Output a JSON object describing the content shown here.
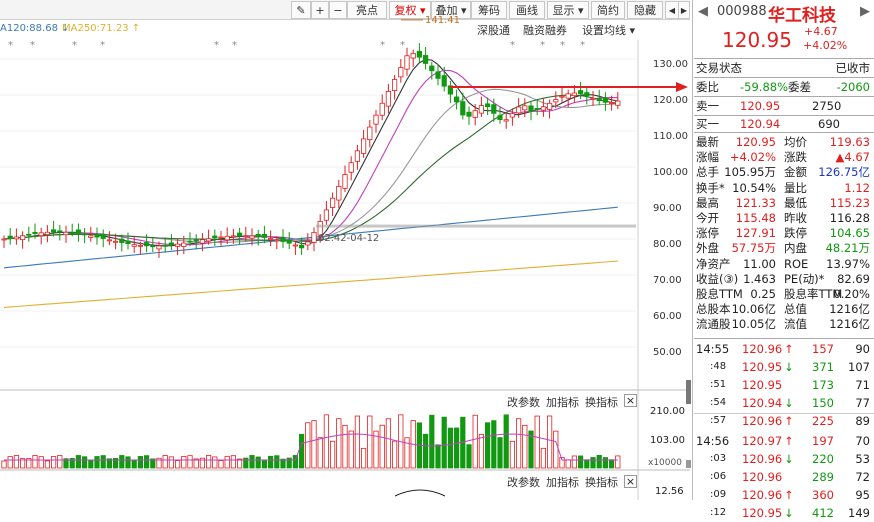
{
  "toolbar": {
    "items": [
      {
        "label": "✎",
        "name": "draw-icon"
      },
      {
        "label": "+",
        "name": "zoom-in-icon"
      },
      {
        "label": "−",
        "name": "zoom-out-icon"
      },
      {
        "label": "亮点"
      },
      {
        "label": "复权 ▾"
      },
      {
        "label": "叠加 ▾"
      },
      {
        "label": "筹码"
      },
      {
        "label": "画线"
      },
      {
        "label": "显示 ▾"
      },
      {
        "label": "简约"
      },
      {
        "label": "隐藏"
      }
    ]
  },
  "subtoolbar": {
    "shenzhen_link": "深股通",
    "margin": "融资融券",
    "ma_setting": "设置均线 ▾",
    "ma120": "A120:88.68 ↓",
    "ma250": "MA250:71.23 ↑"
  },
  "main_chart": {
    "y_ticks": [
      "130.00",
      "120.00",
      "110.00",
      "100.00",
      "90.00",
      "80.00",
      "70.00",
      "60.00",
      "50.00"
    ],
    "high_annotation": "141.41",
    "low_annotation": "62.42-04-12"
  },
  "volume_panel": {
    "buttons": [
      "改参数",
      "加指标",
      "换指标"
    ],
    "close_label": "×",
    "y_ticks": [
      "210.00",
      "103.00",
      "x10000"
    ]
  },
  "macd_panel": {
    "buttons": [
      "改参数",
      "加指标",
      "换指标"
    ],
    "close_label": "×",
    "y_ticks": [
      "12.56"
    ]
  },
  "quote": {
    "code": "000988",
    "name": "华工科技",
    "price": "120.95",
    "change": "+4.67",
    "change_pct": "+4.02%",
    "status_label": "交易状态",
    "status_value": "已收市",
    "weibi_label": "委比",
    "weibi_value": "-59.88%",
    "weicha_label": "委差",
    "weicha_value": "-2060",
    "sell1_label": "卖一",
    "sell1_price": "120.95",
    "sell1_vol": "2750",
    "buy1_label": "买一",
    "buy1_price": "120.94",
    "buy1_vol": "690",
    "stats": [
      {
        "l1": "最新",
        "v1": "120.95",
        "c1": "red",
        "l2": "均价",
        "v2": "119.63",
        "c2": "red"
      },
      {
        "l1": "涨幅",
        "v1": "+4.02%",
        "c1": "red",
        "l2": "涨跌",
        "v2": "▲4.67",
        "c2": "red"
      },
      {
        "l1": "总手",
        "v1": "105.95万",
        "c1": "dark",
        "l2": "金额",
        "v2": "126.75亿",
        "c2": "blue"
      },
      {
        "l1": "换手*",
        "v1": "10.54%",
        "c1": "dark",
        "l2": "量比",
        "v2": "1.12",
        "c2": "red"
      },
      {
        "l1": "最高",
        "v1": "121.33",
        "c1": "red",
        "l2": "最低",
        "v2": "115.23",
        "c2": "red"
      },
      {
        "l1": "今开",
        "v1": "115.48",
        "c1": "red",
        "l2": "昨收",
        "v2": "116.28",
        "c2": "dark"
      },
      {
        "l1": "涨停",
        "v1": "127.91",
        "c1": "red",
        "l2": "跌停",
        "v2": "104.65",
        "c2": "green"
      },
      {
        "l1": "外盘",
        "v1": "57.75万",
        "c1": "red",
        "l2": "内盘",
        "v2": "48.21万",
        "c2": "green"
      },
      {
        "l1": "净资产",
        "v1": "11.00",
        "c1": "dark",
        "l2": "ROE",
        "v2": "13.97%",
        "c2": "dark"
      },
      {
        "l1": "收益(③)",
        "v1": "1.463",
        "c1": "dark",
        "l2": "PE(动)*",
        "v2": "82.69",
        "c2": "dark"
      },
      {
        "l1": "股息TTM",
        "v1": "0.25",
        "c1": "dark",
        "l2": "股息率TTM",
        "v2": "0.20%",
        "c2": "dark"
      },
      {
        "l1": "总股本",
        "v1": "10.06亿",
        "c1": "dark",
        "l2": "总值",
        "v2": "1216亿",
        "c2": "dark"
      },
      {
        "l1": "流通股",
        "v1": "10.05亿",
        "c1": "dark",
        "l2": "流值",
        "v2": "1216亿",
        "c2": "dark"
      }
    ]
  },
  "ticks": [
    {
      "time": "14:55",
      "price": "120.96",
      "dir": "↑",
      "vol": "157",
      "n": "90",
      "vc": "red"
    },
    {
      "time": ":48",
      "price": "120.95",
      "dir": "↓",
      "vol": "371",
      "n": "107",
      "vc": "green"
    },
    {
      "time": ":51",
      "price": "120.95",
      "dir": "",
      "vol": "173",
      "n": "71",
      "vc": "green"
    },
    {
      "time": ":54",
      "price": "120.94",
      "dir": "↓",
      "vol": "150",
      "n": "77",
      "vc": "green"
    },
    {
      "time": ":57",
      "price": "120.96",
      "dir": "↑",
      "vol": "225",
      "n": "89",
      "vc": "red"
    },
    {
      "time": "14:56",
      "price": "120.97",
      "dir": "↑",
      "vol": "197",
      "n": "70",
      "vc": "red"
    },
    {
      "time": ":03",
      "price": "120.96",
      "dir": "↓",
      "vol": "220",
      "n": "53",
      "vc": "green"
    },
    {
      "time": ":06",
      "price": "120.96",
      "dir": "",
      "vol": "289",
      "n": "72",
      "vc": "green"
    },
    {
      "time": ":09",
      "price": "120.96",
      "dir": "↑",
      "vol": "360",
      "n": "95",
      "vc": "red"
    },
    {
      "time": ":12",
      "price": "120.95",
      "dir": "↓",
      "vol": "412",
      "n": "149",
      "vc": "green"
    }
  ],
  "colors": {
    "up": "#e02020",
    "down": "#119911",
    "ma_purple": "#c040c0",
    "ma_olive": "#2e6a2e",
    "ma_blue": "#3a7ab8",
    "ma_yellow": "#e0b030",
    "ma_dark": "#333333"
  }
}
